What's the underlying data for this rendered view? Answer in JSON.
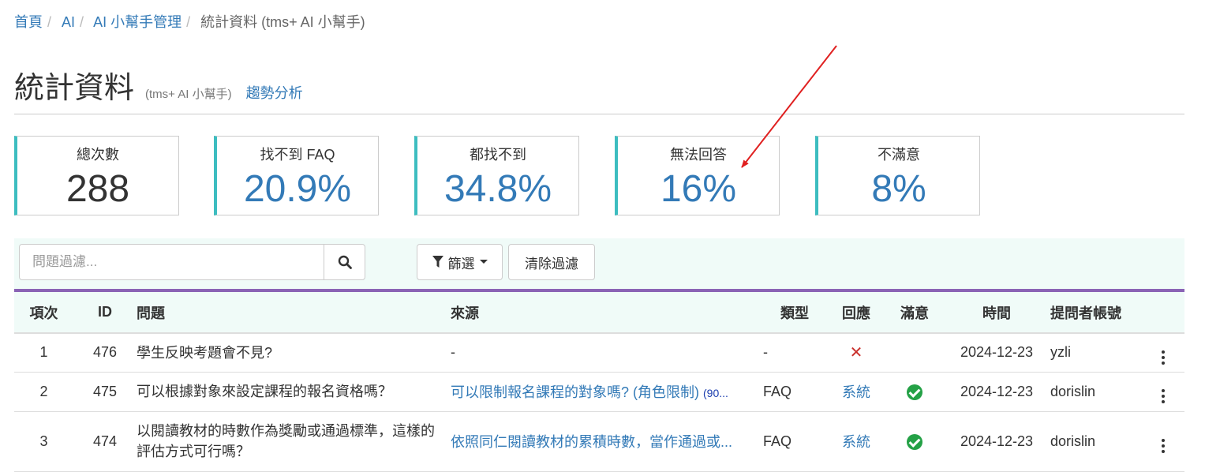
{
  "breadcrumb": {
    "items": [
      "首頁",
      "AI",
      "AI 小幫手管理"
    ],
    "current": "統計資料 (tms+ AI 小幫手)",
    "separator": "/"
  },
  "header": {
    "title": "統計資料",
    "subtitle": "(tms+ AI 小幫手)",
    "trend_link": "趨勢分析"
  },
  "stats": [
    {
      "label": "總次數",
      "value": "288"
    },
    {
      "label": "找不到 FAQ",
      "value": "20.9%"
    },
    {
      "label": "都找不到",
      "value": "34.8%"
    },
    {
      "label": "無法回答",
      "value": "16%"
    },
    {
      "label": "不滿意",
      "value": "8%"
    }
  ],
  "toolbar": {
    "search_placeholder": "問題過濾...",
    "filter_label": "篩選",
    "clear_label": "清除過濾"
  },
  "table": {
    "headers": {
      "index": "項次",
      "id": "ID",
      "question": "問題",
      "source": "來源",
      "type": "類型",
      "response": "回應",
      "satisfied": "滿意",
      "time": "時間",
      "asker": "提問者帳號"
    },
    "rows": [
      {
        "index": "1",
        "id": "476",
        "question": "學生反映考題會不見?",
        "source": "-",
        "source_tag": "",
        "type": "-",
        "response": "",
        "response_icon": "cross-icon",
        "satisfied_icon": "",
        "time": "2024-12-23",
        "asker": "yzli"
      },
      {
        "index": "2",
        "id": "475",
        "question": "可以根據對象來設定課程的報名資格嗎？",
        "source": "可以限制報名課程的對象嗎? (角色限制)",
        "source_tag": "(90...",
        "type": "FAQ",
        "response": "系統",
        "response_icon": "",
        "satisfied_icon": "check-circle-icon",
        "time": "2024-12-23",
        "asker": "dorislin"
      },
      {
        "index": "3",
        "id": "474",
        "question": "以閱讀教材的時數作為獎勵或通過標準，這樣的評估方式可行嗎？",
        "source": "依照同仁閱讀教材的累積時數，當作通過或...",
        "source_tag": "",
        "type": "FAQ",
        "response": "系統",
        "response_icon": "",
        "satisfied_icon": "check-circle-icon",
        "time": "2024-12-23",
        "asker": "dorislin"
      }
    ]
  },
  "colors": {
    "link": "#337ab7",
    "card_accent": "#3dbdc0",
    "table_top_rule": "#8a63b5",
    "annotation_arrow": "#e02020",
    "check": "#24a146",
    "cross": "#c9302c"
  }
}
